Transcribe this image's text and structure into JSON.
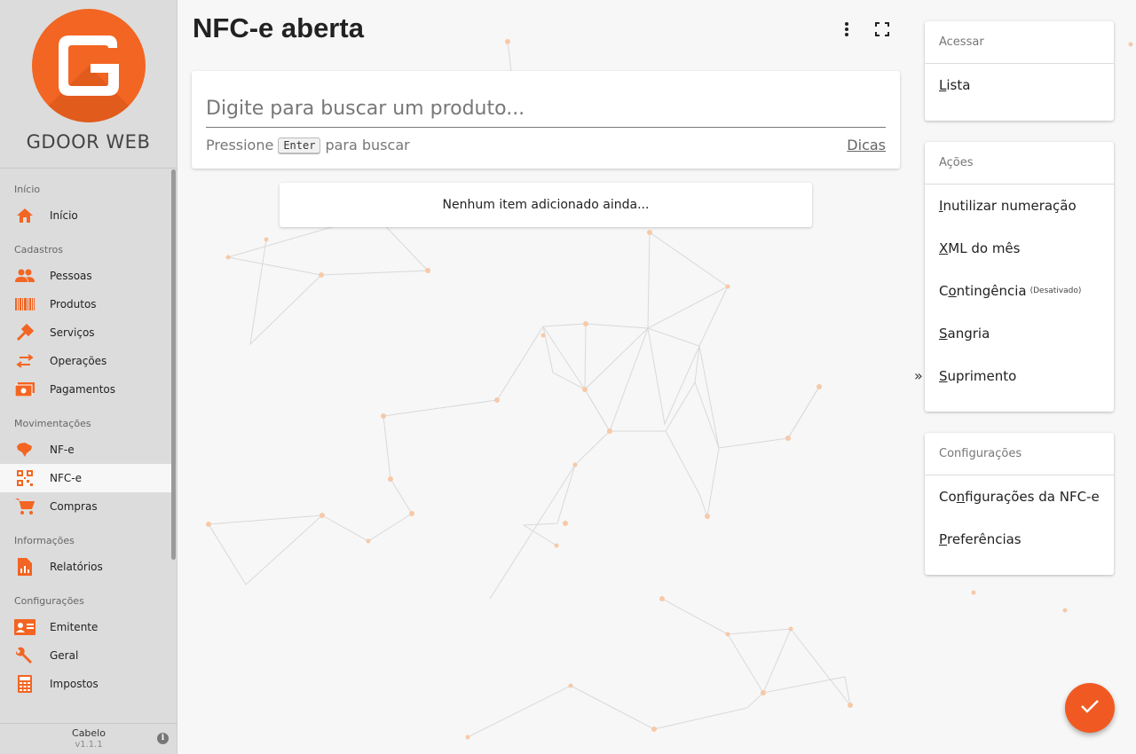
{
  "app": {
    "brand": "GDOOR WEB"
  },
  "sidebar": {
    "sections": [
      {
        "title": "Início",
        "items": [
          {
            "label": "Início",
            "icon": "home-icon"
          }
        ]
      },
      {
        "title": "Cadastros",
        "items": [
          {
            "label": "Pessoas",
            "icon": "people-icon"
          },
          {
            "label": "Produtos",
            "icon": "barcode-icon"
          },
          {
            "label": "Serviços",
            "icon": "tools-icon"
          },
          {
            "label": "Operações",
            "icon": "swap-icon"
          },
          {
            "label": "Pagamentos",
            "icon": "money-icon"
          }
        ]
      },
      {
        "title": "Movimentações",
        "items": [
          {
            "label": "NF-e",
            "icon": "brazil-map-icon"
          },
          {
            "label": "NFC-e",
            "icon": "qrcode-icon",
            "active": true
          },
          {
            "label": "Compras",
            "icon": "cart-icon"
          }
        ]
      },
      {
        "title": "Informações",
        "items": [
          {
            "label": "Relatórios",
            "icon": "report-icon"
          }
        ]
      },
      {
        "title": "Configurações",
        "items": [
          {
            "label": "Emitente",
            "icon": "id-card-icon"
          },
          {
            "label": "Geral",
            "icon": "wrench-icon"
          },
          {
            "label": "Impostos",
            "icon": "calculator-icon"
          }
        ]
      }
    ],
    "footer": {
      "user": "Cabelo",
      "version": "v1.1.1"
    }
  },
  "main": {
    "title": "NFC-e aberta",
    "search": {
      "placeholder": "Digite para buscar um produto...",
      "hint_before": "Pressione",
      "hint_key": "Enter",
      "hint_after": "para buscar",
      "tips": "Dicas"
    },
    "empty_message": "Nenhum item adicionado ainda..."
  },
  "rightpanel": {
    "collapse_glyph": "»",
    "cards": [
      {
        "title": "Acessar",
        "items": [
          {
            "underline": "L",
            "rest": "ista"
          }
        ]
      },
      {
        "title": "Ações",
        "items": [
          {
            "underline": "I",
            "rest": "nutilizar numeração"
          },
          {
            "underline": "X",
            "rest": "ML do mês"
          },
          {
            "prefix": "C",
            "underline": "o",
            "rest": "ntingência",
            "note": "(Desativado)"
          },
          {
            "prefix": "",
            "underline": "S",
            "rest": "angria"
          },
          {
            "underline": "S",
            "rest": "uprimento"
          }
        ]
      },
      {
        "title": "Configurações",
        "items": [
          {
            "prefix": "Co",
            "underline": "n",
            "rest": "figurações da NFC-e"
          },
          {
            "underline": "P",
            "rest": "referências"
          }
        ]
      }
    ]
  },
  "colors": {
    "accent": "#f26522",
    "fab": "#f05a22",
    "sidebar": "#dcdcdc"
  }
}
